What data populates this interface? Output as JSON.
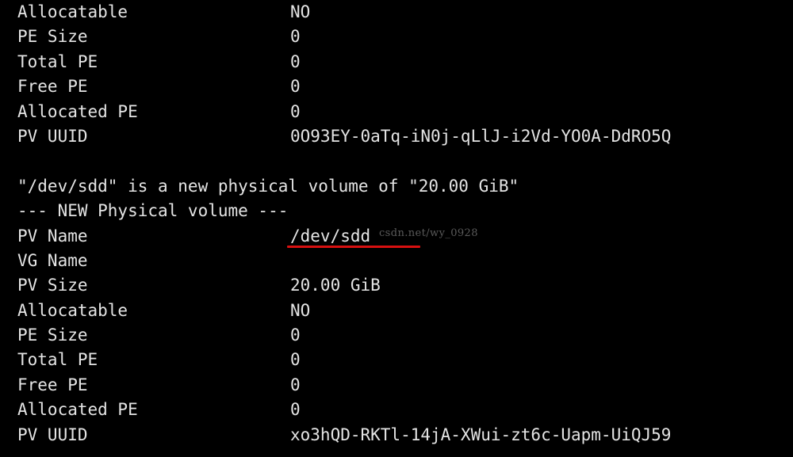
{
  "terminal": {
    "background_color": "#000000",
    "text_color": "#e4e4e4",
    "accent_color": "#d81010",
    "watermark_color": "#5a5a5a",
    "watermark": "csdn.net/wy_0928",
    "blocks": [
      {
        "id": "pv-block-first-tail",
        "rows": [
          {
            "label": "Allocatable",
            "value": "NO"
          },
          {
            "label": "PE Size",
            "value": "0"
          },
          {
            "label": "Total PE",
            "value": "0"
          },
          {
            "label": "Free PE",
            "value": "0"
          },
          {
            "label": "Allocated PE",
            "value": "0"
          },
          {
            "label": "PV UUID",
            "value": "0O93EY-0aTq-iN0j-qLlJ-i2Vd-YO0A-DdRO5Q"
          }
        ]
      },
      {
        "id": "pv-block-second",
        "messages": [
          "\"/dev/sdd\" is a new physical volume of \"20.00 GiB\"",
          "--- NEW Physical volume ---"
        ],
        "rows": [
          {
            "label": "PV Name",
            "value": "/dev/sdd",
            "highlighted": true
          },
          {
            "label": "VG Name",
            "value": ""
          },
          {
            "label": "PV Size",
            "value": "20.00 GiB"
          },
          {
            "label": "Allocatable",
            "value": "NO"
          },
          {
            "label": "PE Size",
            "value": "0"
          },
          {
            "label": "Total PE",
            "value": "0"
          },
          {
            "label": "Free PE",
            "value": "0"
          },
          {
            "label": "Allocated PE",
            "value": "0"
          },
          {
            "label": "PV UUID",
            "value": "xo3hQD-RKTl-14jA-XWui-zt6c-Uapm-UiQJ59"
          }
        ]
      }
    ]
  }
}
